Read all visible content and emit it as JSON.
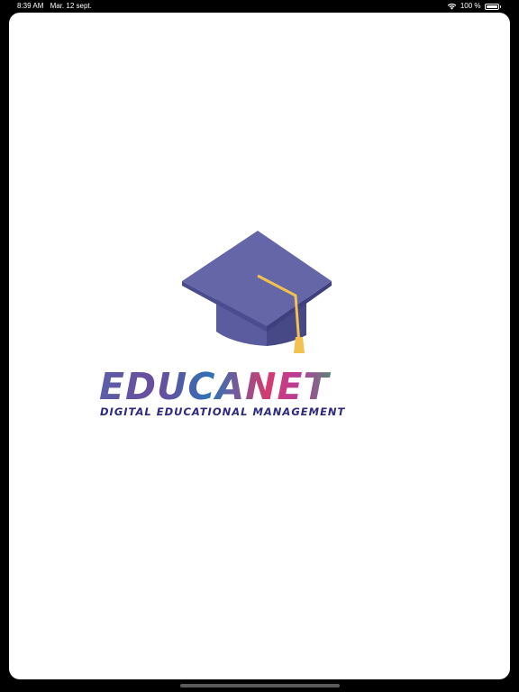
{
  "status_bar": {
    "time": "8:39 AM",
    "date": "Mar. 12 sept.",
    "battery_percent": "100 %",
    "battery_level": 1.0,
    "wifi_icon": "wifi-icon",
    "battery_icon": "battery-icon"
  },
  "splash": {
    "logo_icon": "graduation-cap-icon",
    "brand_name": "EDUCANET",
    "tagline": "DIGITAL EDUCATIONAL MANAGEMENT"
  },
  "colors": {
    "cap_top": "#6466a8",
    "cap_side": "#4b4c8f",
    "tassel": "#f2c14e",
    "tagline": "#2b2a7f"
  }
}
